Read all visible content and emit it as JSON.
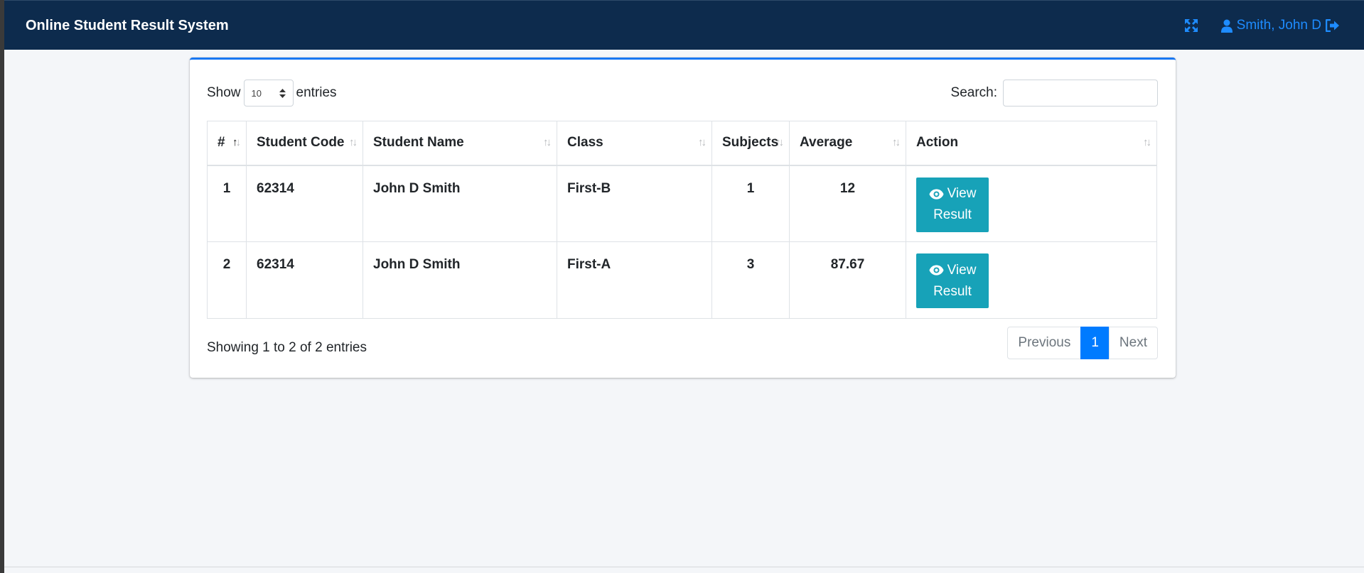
{
  "header": {
    "brand": "Online Student Result System",
    "user_name": "Smith, John D",
    "fullscreen_icon": "expand-arrows-icon",
    "user_icon": "user-icon",
    "logout_icon": "sign-out-icon"
  },
  "controls": {
    "show_label": "Show",
    "entries_label": "entries",
    "length_value": "10",
    "search_label": "Search:",
    "search_value": ""
  },
  "table": {
    "columns": [
      "#",
      "Student Code",
      "Student Name",
      "Class",
      "Subjects",
      "Average",
      "Action"
    ],
    "rows": [
      {
        "num": "1",
        "code": "62314",
        "name": "John D Smith",
        "class": "First-B",
        "subjects": "1",
        "average": "12"
      },
      {
        "num": "2",
        "code": "62314",
        "name": "John D Smith",
        "class": "First-A",
        "subjects": "3",
        "average": "87.67"
      }
    ],
    "action_label_1": "View",
    "action_label_2": "Result"
  },
  "footer": {
    "info": "Showing 1 to 2 of 2 entries",
    "previous": "Previous",
    "current_page": "1",
    "next": "Next"
  },
  "colors": {
    "topbar": "#0d2b4d",
    "accent": "#1877f2",
    "button": "#17a2b8",
    "link": "#1e8cff"
  }
}
